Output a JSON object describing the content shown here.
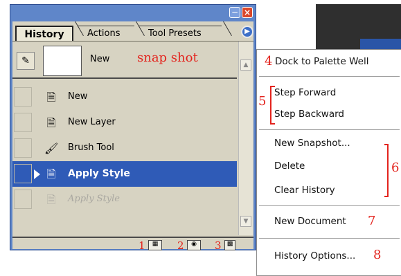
{
  "palette": {
    "tabs": [
      "History",
      "Actions",
      "Tool Presets"
    ],
    "snapshot": {
      "name": "New",
      "annotation": "snap shot"
    },
    "states": [
      {
        "label": "New",
        "icon": "document-icon"
      },
      {
        "label": "New Layer",
        "icon": "document-icon"
      },
      {
        "label": "Brush Tool",
        "icon": "brush-icon"
      },
      {
        "label": "Apply Style",
        "icon": "document-icon",
        "active": true
      },
      {
        "label": "Apply Style",
        "icon": "document-icon",
        "disabled": true
      }
    ],
    "footer": {
      "num1": "1",
      "new_document_icon": "new-document-icon",
      "num2": "2",
      "snapshot_icon": "camera-icon",
      "num3": "3",
      "delete_icon": "trash-icon"
    }
  },
  "menu": {
    "dock_num": "4",
    "dock": "Dock to Palette Well",
    "step_num": "5",
    "step_forward": "Step Forward",
    "step_backward": "Step Backward",
    "new_snapshot": "New Snapshot...",
    "delete": "Delete",
    "clear_history": "Clear History",
    "group_num": "6",
    "new_document": "New Document",
    "new_document_num": "7",
    "history_options": "History Options...",
    "history_options_num": "8"
  },
  "colors": {
    "annotation": "#e3231d",
    "selection": "#2f5bb7",
    "titlebar": "#5f86c9"
  }
}
